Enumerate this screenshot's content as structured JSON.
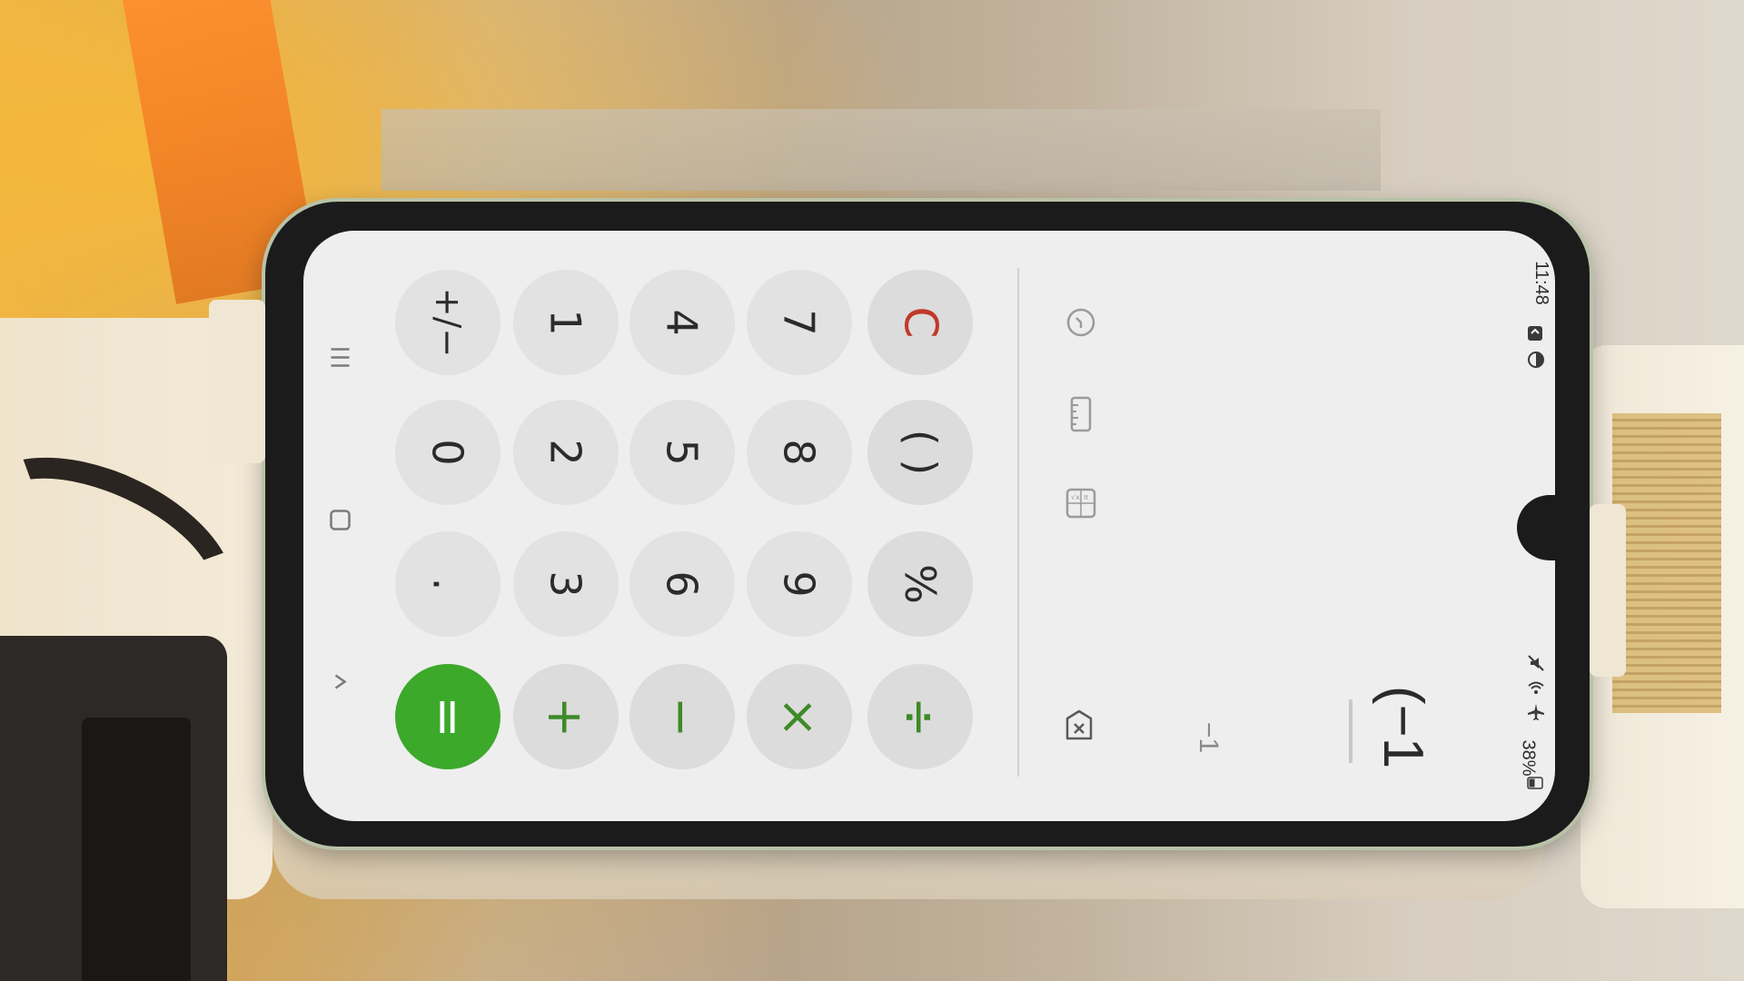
{
  "status_bar": {
    "time": "11:48",
    "battery": "38%"
  },
  "display": {
    "formula": "(−1",
    "preview": "−1"
  },
  "keypad": {
    "row1": [
      "C",
      "( )",
      "%",
      "÷"
    ],
    "row2": [
      "7",
      "8",
      "9",
      "×"
    ],
    "row3": [
      "4",
      "5",
      "6",
      "−"
    ],
    "row4": [
      "1",
      "2",
      "3",
      "+"
    ],
    "row5": [
      "+/−",
      "0",
      ".",
      "="
    ]
  },
  "colors": {
    "operator": "#3f8a28",
    "clear": "#c0392b",
    "equals_bg": "#3ca92a"
  },
  "icons": {
    "history": "history-icon",
    "unit_converter": "ruler-icon",
    "scientific": "scientific-icon",
    "backspace": "backspace-icon",
    "nav_recent": "recents-icon",
    "nav_home": "home-icon",
    "nav_back": "back-icon"
  }
}
